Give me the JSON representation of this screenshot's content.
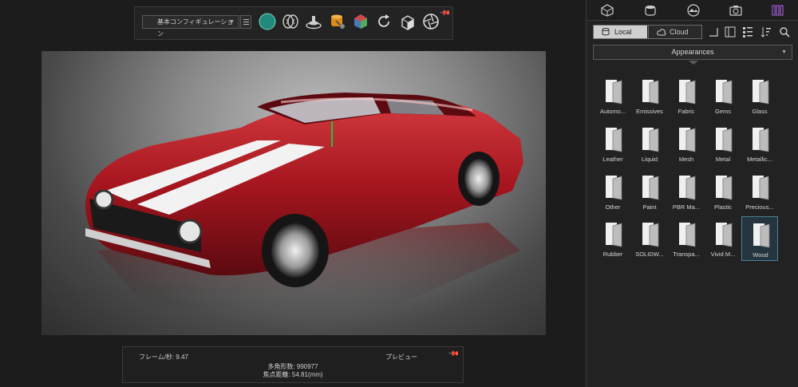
{
  "toolbar": {
    "configuration": "基本コンフィギュレーション",
    "icons": [
      "config-menu-icon",
      "color-sphere-icon",
      "brain-ai-icon",
      "turntable-icon",
      "environment-icon",
      "gem-material-icon",
      "refresh-icon",
      "cube-camera-icon",
      "aperture-icon",
      "pin-icon"
    ]
  },
  "status": {
    "fps": "フレーム/秒: 9.47",
    "mode": "プレビュー",
    "polygons": "多角形数: 990977",
    "focal": "焦点距離: 54.81(mm)"
  },
  "panel": {
    "tabs": [
      "model-tab-icon",
      "material-tab-icon",
      "environment-tab-icon",
      "camera-tab-icon",
      "library-tab-icon"
    ],
    "active_tab": "library-tab-icon",
    "source_local": "Local",
    "source_cloud": "Cloud",
    "category": "Appearances",
    "folders": [
      "Automo...",
      "Emissives",
      "Fabric",
      "Gems",
      "Glass",
      "Leather",
      "Liquid",
      "Mesh",
      "Metal",
      "Metallic...",
      "Other",
      "Paint",
      "PBR Ma...",
      "Plastic",
      "Precious...",
      "Rubber",
      "SOLIDW...",
      "Transpa...",
      "Vivid M...",
      "Wood"
    ],
    "selected_folder": "Wood"
  },
  "colors": {
    "accent": "#1f8a7a",
    "selection": "#4d7f97",
    "active_tab": "#9b59d0",
    "car_red": "#a5151e"
  }
}
